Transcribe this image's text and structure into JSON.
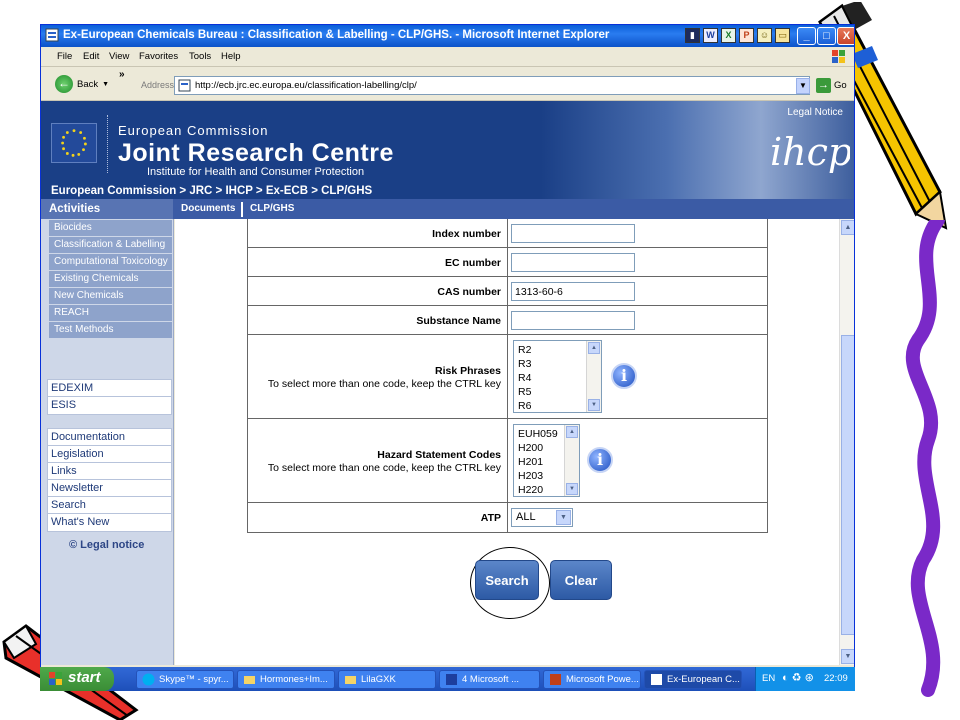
{
  "window": {
    "title": "Ex-European Chemicals Bureau : Classification & Labelling - CLP/GHS. - Microsoft Internet Explorer",
    "min": "_",
    "max": "□",
    "close": "X"
  },
  "menu": [
    "File",
    "Edit",
    "View",
    "Favorites",
    "Tools",
    "Help"
  ],
  "toolbar": {
    "back": "Back",
    "more": "»",
    "address_label": "Address",
    "url": "http://ecb.jrc.ec.europa.eu/classification-labelling/clp/",
    "go": "Go"
  },
  "banner": {
    "legal_notice": "Legal Notice",
    "ec": "European Commission",
    "jrc": "Joint Research Centre",
    "institute": "Institute for Health and Consumer Protection",
    "breadcrumb": "European Commission > JRC > IHCP > Ex-ECB > CLP/GHS",
    "ihcp_logo": "ihcp"
  },
  "navstrip": {
    "activities": "Activities",
    "tabs": [
      "Documents",
      "CLP/GHS"
    ]
  },
  "sidebar": {
    "activities": [
      "Biocides",
      "Classification & Labelling",
      "Computational Toxicology",
      "Existing Chemicals",
      "New Chemicals",
      "REACH",
      "Test Methods"
    ],
    "group1": [
      "EDEXIM",
      "ESIS"
    ],
    "group2": [
      "Documentation",
      "Legislation",
      "Links",
      "Newsletter",
      "Search",
      "What's New"
    ],
    "legal": "© Legal notice"
  },
  "form": {
    "index_number": {
      "label": "Index number",
      "value": ""
    },
    "ec_number": {
      "label": "EC number",
      "value": ""
    },
    "cas_number": {
      "label": "CAS number",
      "value": "1313-60-6"
    },
    "substance_name": {
      "label": "Substance Name",
      "value": ""
    },
    "risk_phrases": {
      "label": "Risk Phrases",
      "hint": "To select more than one code, keep the CTRL key",
      "options": [
        "R2",
        "R3",
        "R4",
        "R5",
        "R6"
      ]
    },
    "hazard_codes": {
      "label": "Hazard Statement Codes",
      "hint": "To select more than one code, keep the CTRL key",
      "options": [
        "EUH059",
        "H200",
        "H201",
        "H203",
        "H220"
      ]
    },
    "atp": {
      "label": "ATP",
      "value": "ALL"
    },
    "info_glyph": "i",
    "search": "Search",
    "clear": "Clear"
  },
  "taskbar": {
    "start": "start",
    "items": [
      "Skype™ - spyr...",
      "Hormones+Im...",
      "LilaGXK",
      "4 Microsoft ...",
      "Microsoft Powe...",
      "Ex-European C..."
    ],
    "lang": "EN",
    "clock": "22:09"
  },
  "colors": {
    "banner": "#1a3f86",
    "nav": "#3b5ba5",
    "button": "#2d5aa5",
    "titlebar": "#0a5fd8"
  }
}
